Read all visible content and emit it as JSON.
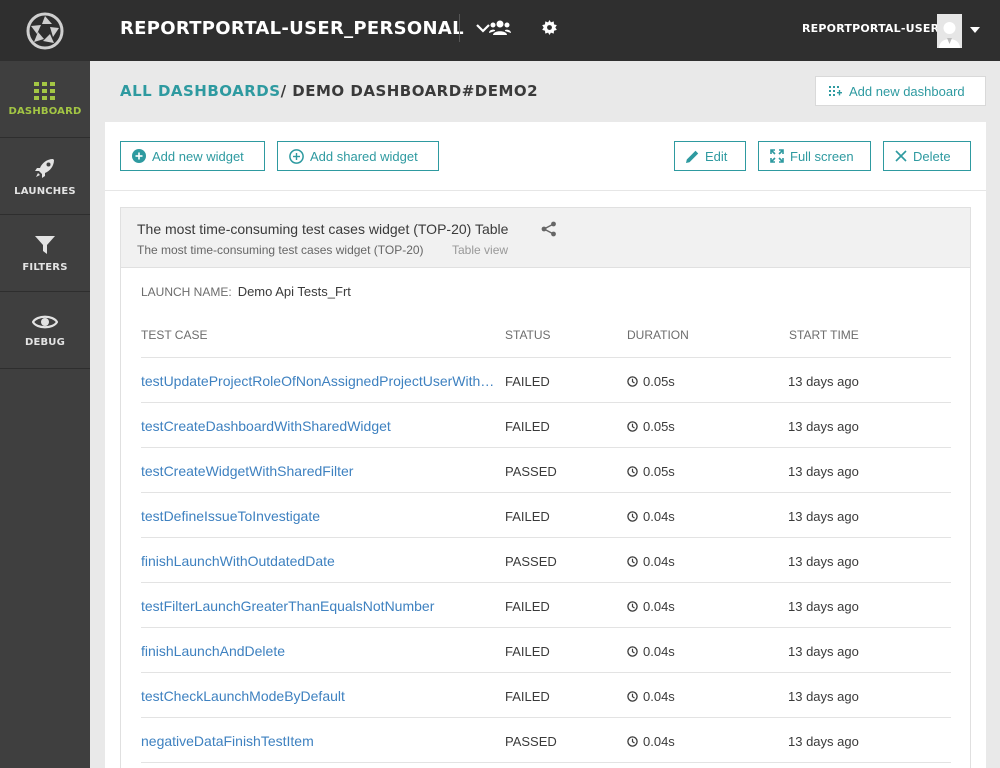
{
  "header": {
    "project_name": "REPORTPORTAL-USER_PERSONAL",
    "user_name": "REPORTPORTAL-USER"
  },
  "sidebar": {
    "items": [
      {
        "label": "DASHBOARD",
        "icon": "grid-icon",
        "active": true
      },
      {
        "label": "LAUNCHES",
        "icon": "rocket-icon",
        "active": false
      },
      {
        "label": "FILTERS",
        "icon": "funnel-icon",
        "active": false
      },
      {
        "label": "DEBUG",
        "icon": "eye-icon",
        "active": false
      }
    ]
  },
  "breadcrumb": {
    "all_dashboards": "ALL DASHBOARDS",
    "separator": "/",
    "current": "DEMO DASHBOARD#DEMO2"
  },
  "add_dashboard_label": "Add new dashboard",
  "toolbar": {
    "add_widget": "Add new widget",
    "add_shared_widget": "Add shared widget",
    "edit": "Edit",
    "full_screen": "Full screen",
    "delete": "Delete"
  },
  "widget": {
    "title": "The most time-consuming test cases widget (TOP-20) Table",
    "subtitle": "The most time-consuming test cases widget (TOP-20)",
    "view": "Table view",
    "launch_label": "LAUNCH NAME:",
    "launch_name": "Demo Api Tests_Frt",
    "columns": [
      "TEST CASE",
      "STATUS",
      "DURATION",
      "START TIME"
    ],
    "rows": [
      {
        "name": "testUpdateProjectRoleOfNonAssignedProjectUserWithPermissions",
        "status": "FAILED",
        "duration": "0.05s",
        "start": "13 days ago"
      },
      {
        "name": "testCreateDashboardWithSharedWidget",
        "status": "FAILED",
        "duration": "0.05s",
        "start": "13 days ago"
      },
      {
        "name": "testCreateWidgetWithSharedFilter",
        "status": "PASSED",
        "duration": "0.05s",
        "start": "13 days ago"
      },
      {
        "name": "testDefineIssueToInvestigate",
        "status": "FAILED",
        "duration": "0.04s",
        "start": "13 days ago"
      },
      {
        "name": "finishLaunchWithOutdatedDate",
        "status": "PASSED",
        "duration": "0.04s",
        "start": "13 days ago"
      },
      {
        "name": "testFilterLaunchGreaterThanEqualsNotNumber",
        "status": "FAILED",
        "duration": "0.04s",
        "start": "13 days ago"
      },
      {
        "name": "finishLaunchAndDelete",
        "status": "FAILED",
        "duration": "0.04s",
        "start": "13 days ago"
      },
      {
        "name": "testCheckLaunchModeByDefault",
        "status": "FAILED",
        "duration": "0.04s",
        "start": "13 days ago"
      },
      {
        "name": "negativeDataFinishTestItem",
        "status": "PASSED",
        "duration": "0.04s",
        "start": "13 days ago"
      }
    ]
  },
  "colors": {
    "accent": "#2e9aa0",
    "active_nav": "#a3c644",
    "link": "#3e81c0"
  }
}
